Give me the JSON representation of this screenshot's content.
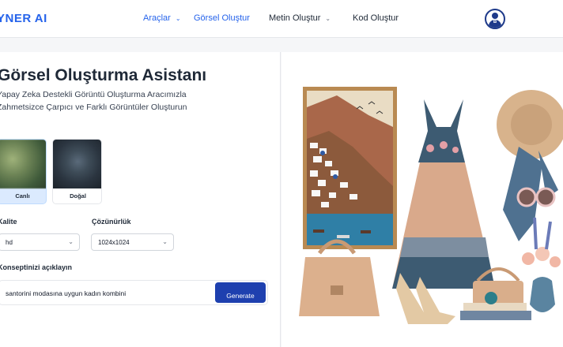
{
  "header": {
    "brand": "YNER AI",
    "nav": [
      {
        "label": "Araçlar",
        "dropdown": true,
        "active": true
      },
      {
        "label": "Görsel Oluştur",
        "dropdown": false,
        "active": true
      },
      {
        "label": "Metin Oluştur",
        "dropdown": true,
        "active": false
      },
      {
        "label": "Kod Oluştur",
        "dropdown": false,
        "active": false
      }
    ],
    "avatar_letter": "B"
  },
  "main": {
    "title": "Görsel Oluşturma Asistanı",
    "subtitle_line1": "Yapay Zeka Destekli Görüntü Oluşturma Aracımızla",
    "subtitle_line2": "Zahmetsizce Çarpıcı ve Farklı Görüntüler Oluşturun",
    "styles": [
      {
        "label": "Canlı",
        "selected": true
      },
      {
        "label": "Doğal",
        "selected": false
      }
    ],
    "quality": {
      "label": "Kalite",
      "value": "hd"
    },
    "resolution": {
      "label": "Çözünürlük",
      "value": "1024x1024"
    },
    "concept": {
      "label": "Konseptinizi açıklayın",
      "value": "santorini modasına uygun kadın kombini"
    },
    "generate_label": "Generate"
  },
  "colors": {
    "accent": "#2563eb",
    "button": "#1e40af",
    "selected_card": "#dbeafe"
  },
  "icons": {
    "chevron": "chevron-down-icon",
    "avatar": "user-avatar-icon"
  }
}
